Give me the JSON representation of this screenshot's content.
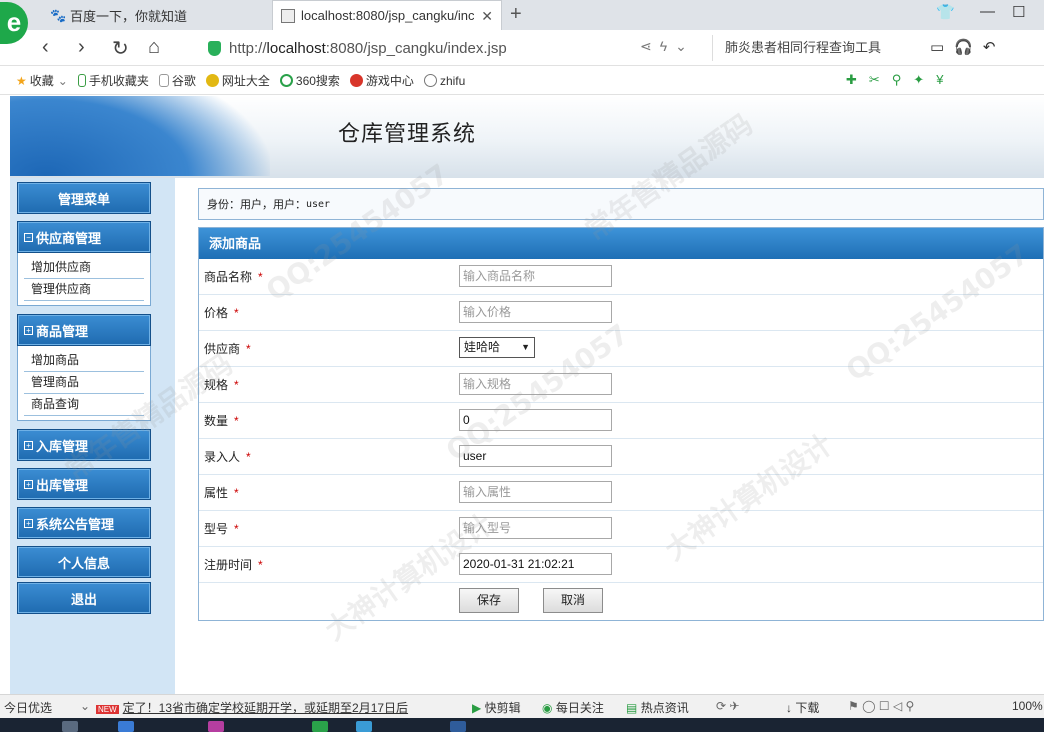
{
  "browser": {
    "tabs": [
      {
        "title": "百度一下，你就知道"
      },
      {
        "title": "localhost:8080/jsp_cangku/inc"
      }
    ],
    "new_tab": "+",
    "url_prefix": "http://",
    "url_host": "localhost",
    "url_rest": ":8080/jsp_cangku/index.jsp",
    "search_hint": "肺炎患者相同行程查询工具",
    "bookmarks": [
      "收藏",
      "手机收藏夹",
      "谷歌",
      "网址大全",
      "360搜索",
      "游戏中心",
      "zhifu"
    ]
  },
  "page": {
    "system_title": "仓库管理系统",
    "identity_label": "身份：用户，用户：",
    "identity_user": "user",
    "sidebar": {
      "menu_title": "管理菜单",
      "groups": [
        {
          "label": "供应商管理",
          "items": [
            "增加供应商",
            "管理供应商"
          ]
        },
        {
          "label": "商品管理",
          "items": [
            "增加商品",
            "管理商品",
            "商品查询"
          ]
        },
        {
          "label": "入库管理"
        },
        {
          "label": "出库管理"
        },
        {
          "label": "系统公告管理"
        }
      ],
      "personal_info": "个人信息",
      "logout": "退出"
    },
    "form": {
      "title": "添加商品",
      "required_mark": "*",
      "fields": [
        {
          "label": "商品名称",
          "value": "",
          "placeholder": "输入商品名称"
        },
        {
          "label": "价格",
          "value": "",
          "placeholder": "输入价格"
        },
        {
          "label": "供应商",
          "selected": "娃哈哈"
        },
        {
          "label": "规格",
          "value": "",
          "placeholder": "输入规格"
        },
        {
          "label": "数量",
          "value": "0",
          "placeholder": ""
        },
        {
          "label": "录入人",
          "value": "user",
          "placeholder": ""
        },
        {
          "label": "属性",
          "value": "",
          "placeholder": "输入属性"
        },
        {
          "label": "型号",
          "value": "",
          "placeholder": "输入型号"
        },
        {
          "label": "注册时间",
          "value": "2020-01-31 21:02:21",
          "placeholder": ""
        }
      ],
      "save_label": "保存",
      "cancel_label": "取消"
    }
  },
  "statusbar": {
    "left": "今日优选",
    "news": "定了！13省市确定学校延期开学，或延期至2月17日后",
    "quick_edit": "快剪辑",
    "daily": "每日关注",
    "hot": "热点资讯",
    "download": "下载",
    "zoom": "100%"
  },
  "watermark": {
    "qq": "QQ:25454057",
    "text1": "常年售精品源码",
    "text2": "大神计算机设计"
  }
}
